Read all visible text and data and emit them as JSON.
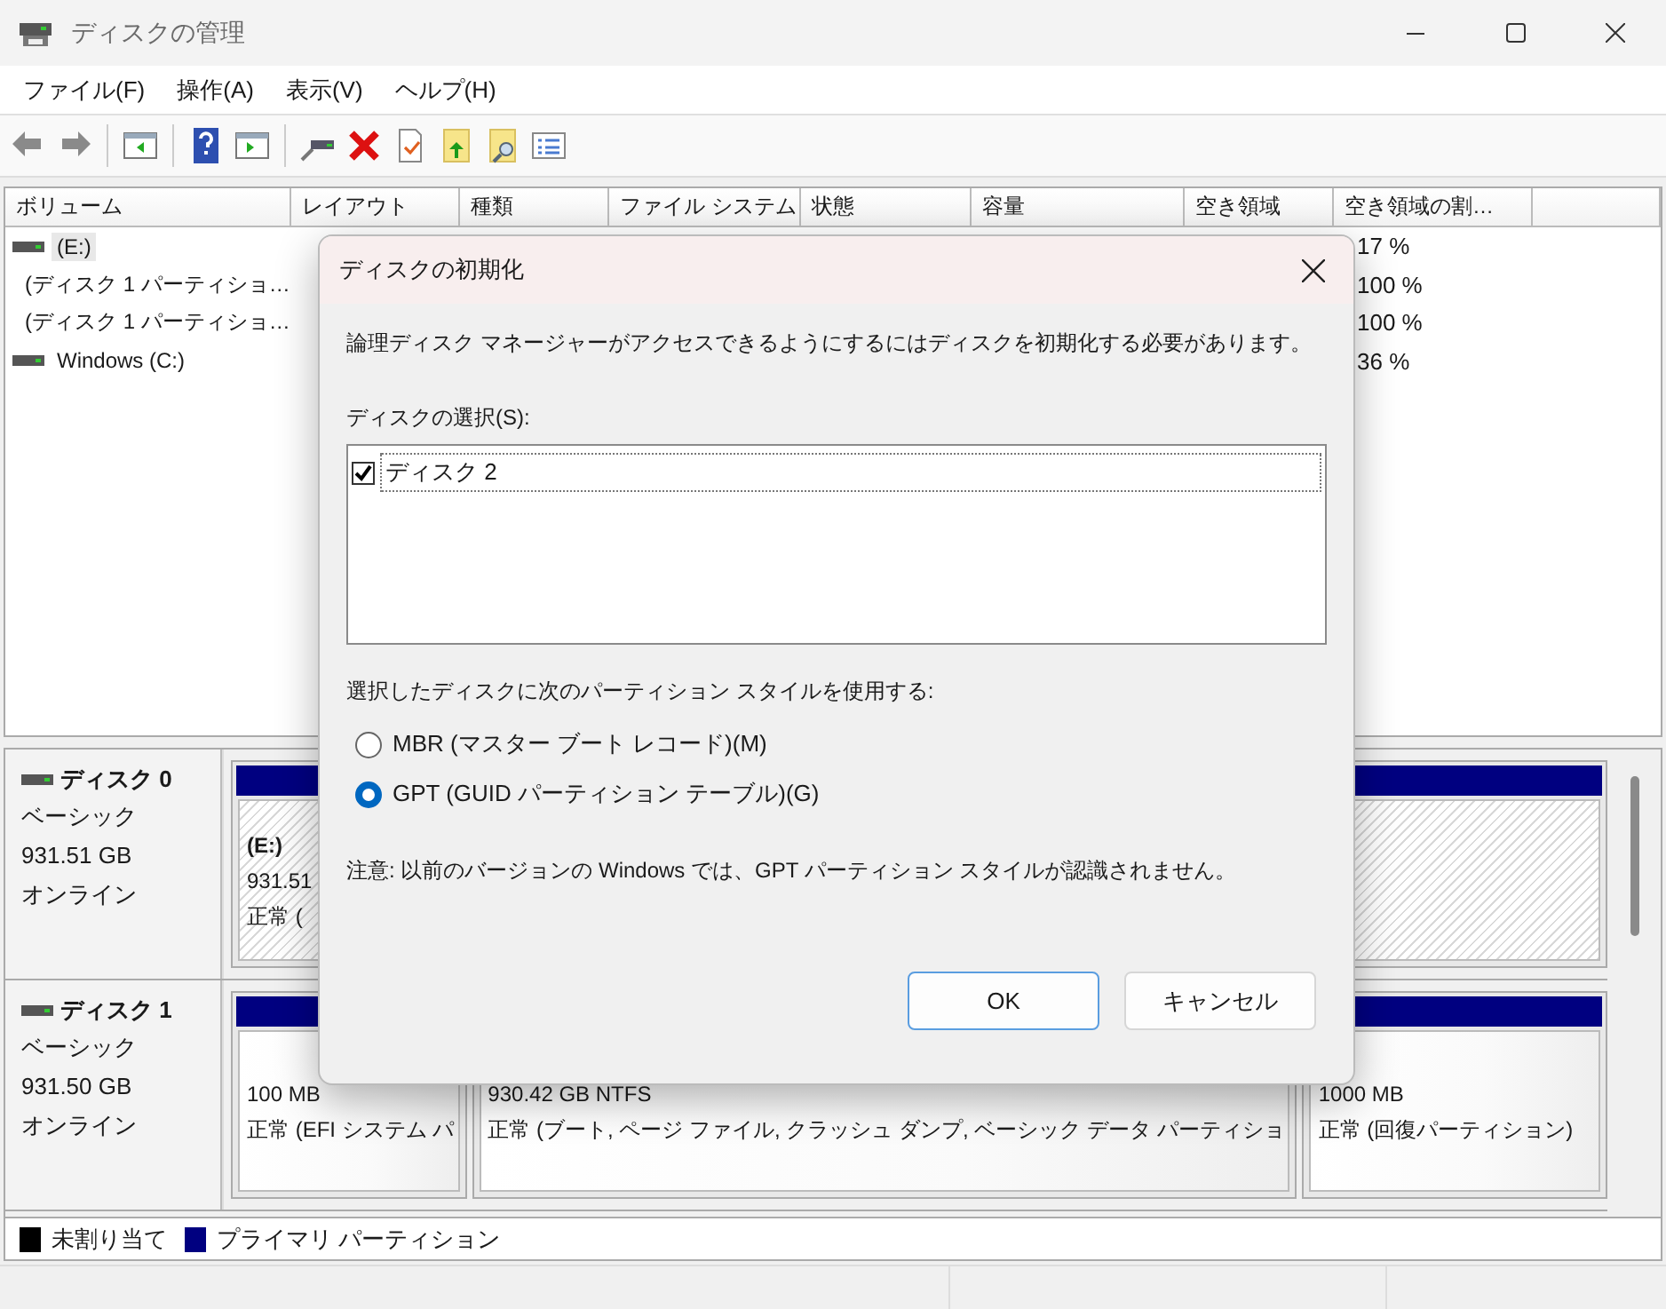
{
  "window": {
    "title": "ディスクの管理"
  },
  "menu": [
    "ファイル(F)",
    "操作(A)",
    "表示(V)",
    "ヘルプ(H)"
  ],
  "volume_table": {
    "columns": [
      "ボリューム",
      "レイアウト",
      "種類",
      "ファイル システム",
      "状態",
      "容量",
      "空き領域",
      "空き領域の割…"
    ],
    "rows": [
      {
        "volume": "(E:)",
        "free_percent": "17 %",
        "selected": true
      },
      {
        "volume": "(ディスク 1 パーティショ…",
        "free_percent": "100 %",
        "selected": false
      },
      {
        "volume": "(ディスク 1 パーティショ…",
        "free_percent": "100 %",
        "selected": false
      },
      {
        "volume": "Windows (C:)",
        "free_percent": "36 %",
        "selected": false
      }
    ]
  },
  "disks": [
    {
      "name": "ディスク 0",
      "type": "ベーシック",
      "size": "931.51 GB",
      "status": "オンライン",
      "partitions": [
        {
          "lines": [
            "(E:)",
            "931.51",
            "正常 ("
          ],
          "selected": true
        }
      ]
    },
    {
      "name": "ディスク 1",
      "type": "ベーシック",
      "size": "931.50 GB",
      "status": "オンライン",
      "partitions": [
        {
          "lines": [
            "100 MB",
            "正常 (EFI システム パ"
          ],
          "selected": false
        },
        {
          "lines": [
            "930.42 GB NTFS",
            "正常 (ブート, ページ ファイル, クラッシュ ダンプ, ベーシック データ パーティショ"
          ],
          "selected": false
        },
        {
          "lines": [
            "1000 MB",
            "正常 (回復パーティション)"
          ],
          "selected": false
        }
      ]
    }
  ],
  "legend": [
    {
      "label": "未割り当て",
      "color": "#000000"
    },
    {
      "label": "プライマリ パーティション",
      "color": "#000080"
    }
  ],
  "dialog": {
    "title": "ディスクの初期化",
    "message": "論理ディスク マネージャーがアクセスできるようにするにはディスクを初期化する必要があります。",
    "disk_list_label": "ディスクの選択(S):",
    "disks": [
      {
        "label": "ディスク 2",
        "checked": true
      }
    ],
    "style_label": "選択したディスクに次のパーティション スタイルを使用する:",
    "styles": [
      {
        "label": "MBR (マスター ブート レコード)(M)",
        "selected": false
      },
      {
        "label": "GPT (GUID パーティション テーブル)(G)",
        "selected": true
      }
    ],
    "note": "注意: 以前のバージョンの Windows では、GPT パーティション スタイルが認識されません。",
    "buttons": [
      {
        "label": "OK",
        "default": true
      },
      {
        "label": "キャンセル",
        "default": false
      }
    ]
  }
}
